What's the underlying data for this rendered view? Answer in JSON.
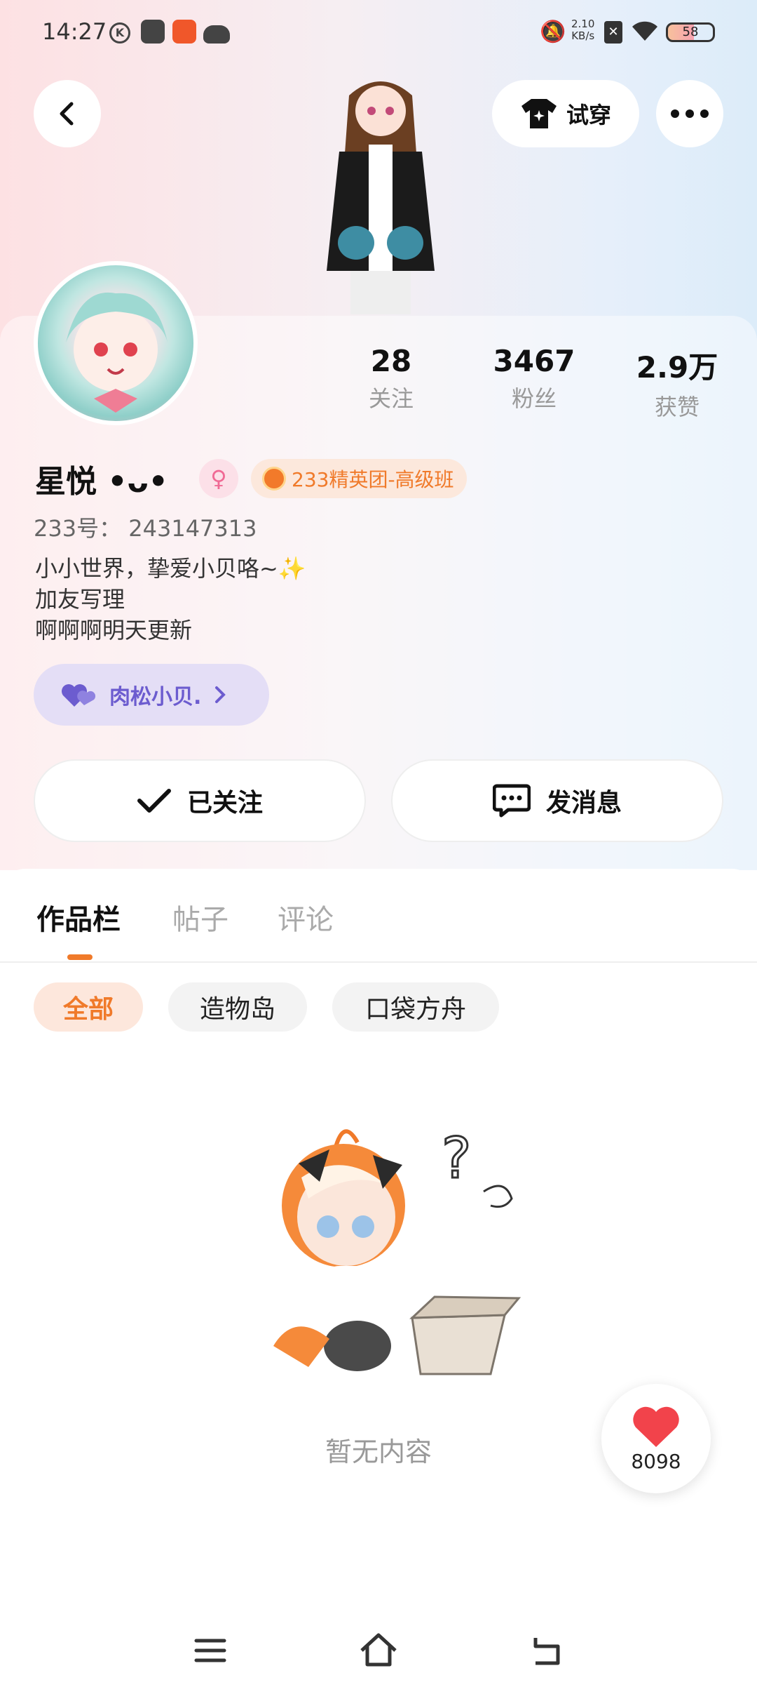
{
  "status_bar": {
    "time": "14:27",
    "speed_value": "2.10",
    "speed_unit": "KB/s",
    "battery": "58"
  },
  "top_bar": {
    "try_on_label": "试穿"
  },
  "profile": {
    "stats": [
      {
        "value": "28",
        "label": "关注"
      },
      {
        "value": "3467",
        "label": "粉丝"
      },
      {
        "value": "2.9万",
        "label": "获赞"
      }
    ],
    "name": "星悦 •ᴗ•",
    "group_badge": "233精英团-高级班",
    "uid": "233号：  243147313",
    "bio": "小小世界，挚爱小贝咯~✨\n加友写理\n啊啊啊明天更新",
    "cp_chip": "肉松小贝."
  },
  "actions": {
    "follow_label": "已关注",
    "message_label": "发消息"
  },
  "tabs": [
    "作品栏",
    "帖子",
    "评论"
  ],
  "filters": [
    "全部",
    "造物岛",
    "口袋方舟"
  ],
  "empty_text": "暂无内容",
  "like_count": "8098",
  "colors": {
    "accent": "#f07a2a",
    "cp_purple": "#6c5ccf",
    "heart": "#f2434b"
  }
}
